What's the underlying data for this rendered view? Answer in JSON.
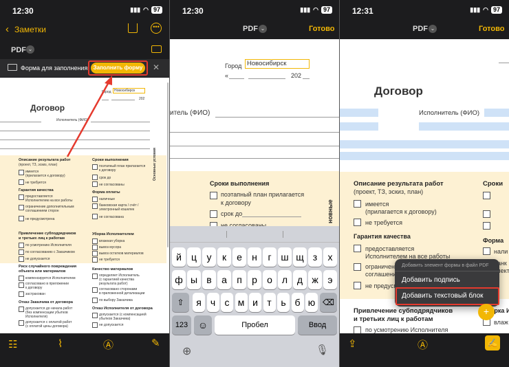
{
  "panel1": {
    "status": {
      "time": "12:30",
      "battery": "97"
    },
    "nav": {
      "back_label": "Заметки"
    },
    "toolbar": {
      "doc_label": "PDF"
    },
    "form_bar": {
      "label": "Форма для заполнения",
      "fill_button": "Заполнить форму"
    },
    "doc": {
      "city": "Город",
      "city_value": "Новосибирск",
      "year": "202",
      "title": "Договор",
      "executor": "Исполнитель (ФИО)",
      "sec1_title": "Описание результата работ",
      "sec1_sub": "(проект, ТЗ, эскиз, план)",
      "sec1_items": [
        "имеется",
        "(прилагается к договору)",
        "не требуется"
      ],
      "sec2_title": "Гарантия качества",
      "sec2_items": [
        "предоставляется",
        "Исполнителем на все работы",
        "ограничение дополнительным",
        "соглашением сторон",
        "не предусмотрена"
      ],
      "sec3_title": "Сроки выполнения",
      "sec3_items": [
        "поэтапный план прилагается",
        "к договору",
        "срок до",
        "не согласованы"
      ],
      "sec4_title": "Форма оплаты",
      "sec4_items": [
        "наличные",
        "банковская карта / счёт /",
        "электронный кошелек",
        "не согласована"
      ],
      "side_label": "Основные условия",
      "sec5_title": "Привлечение субподрядчиков",
      "sec5_sub": "и третьих лиц к работам",
      "sec5_items": [
        "по усмотрению Исполнителя",
        "по согласованию с Заказчиком",
        "не допускается"
      ],
      "sec6_title": "Риск случайного повреждения",
      "sec6_sub": "объекта или материалов",
      "sec6_items": [
        "компенсируется Исполнителем",
        "согласовано в приложении",
        "к договору",
        "застрахован"
      ],
      "sec7_title": "Отказ Заказчика от договора",
      "sec7_items": [
        "допускается до начала работ",
        "(без компенсации убытков",
        "Исполнителя)",
        "допускается с оплатой работ",
        "(с оплатой цены договора)"
      ],
      "sec8_title": "Уборка Исполнителем",
      "sec8_items": [
        "влажная уборка",
        "вывоз мусора",
        "вывоз остатков материалов",
        "не требуется"
      ],
      "sec9_title": "Качество материалов",
      "sec9_items": [
        "определяет Исполнитель",
        "(с гарантией качества",
        "результата работ)",
        "согласовано сторонами",
        "в приложенной детализации",
        "по выбору Заказчика"
      ],
      "sec10_title": "Отказ Исполнителя от договора",
      "sec10_items": [
        "допускается (с компенсацией",
        "убытков Заказчика)",
        "не допускается"
      ]
    }
  },
  "panel2": {
    "status": {
      "time": "12:30",
      "battery": "97"
    },
    "header": {
      "title": "PDF",
      "done": "Готово"
    },
    "doc": {
      "city": "Город",
      "city_value": "Новосибирск",
      "date_prefix": "«",
      "year": "202",
      "executor": "итель (ФИО)",
      "sec_title": "Сроки выполнения",
      "items": [
        "поэтапный план прилагается",
        "к договору",
        "срок до",
        "не согласованы"
      ],
      "side_label": "новные"
    },
    "keyboard": {
      "row1": [
        "й",
        "ц",
        "у",
        "к",
        "е",
        "н",
        "г",
        "ш",
        "щ",
        "з",
        "х"
      ],
      "row2": [
        "ф",
        "ы",
        "в",
        "а",
        "п",
        "р",
        "о",
        "л",
        "д",
        "ж",
        "э"
      ],
      "row3": [
        "я",
        "ч",
        "с",
        "м",
        "и",
        "т",
        "ь",
        "б",
        "ю"
      ],
      "numbers": "123",
      "space": "Пробел",
      "enter": "Ввод"
    }
  },
  "panel3": {
    "status": {
      "time": "12:31",
      "battery": "97"
    },
    "header": {
      "title": "PDF",
      "done": "Готово"
    },
    "doc": {
      "title": "Договор",
      "executor": "Исполнитель (ФИО)",
      "sec1_title": "Описание результата работ",
      "sec1_sub": "(проект, ТЗ, эскиз, план)",
      "sec1_items": [
        "имеется",
        "(прилагается к договору)",
        "не требуется"
      ],
      "sec2_title": "Гарантия качества",
      "sec2_items": [
        "предоставляется",
        "Исполнителем на все работы",
        "ограничен",
        "соглашени",
        "не предусм"
      ],
      "sec3_title": "Сроки",
      "sec4_title": "Форма",
      "sec4_items": [
        "нали",
        "банк",
        "элект"
      ],
      "sec5_title": "Привлечение субподрядчиков",
      "sec5_sub": "и третьих лиц к работам",
      "sec5_items": [
        "по усмотрению Исполнителя"
      ],
      "sec6_title": "Уборка И",
      "sec6_items": [
        "влаж"
      ]
    },
    "menu": {
      "header": "Добавить элемент формы в файл PDF",
      "items": [
        "Добавить подпись",
        "Добавить текстовый блок"
      ]
    }
  }
}
